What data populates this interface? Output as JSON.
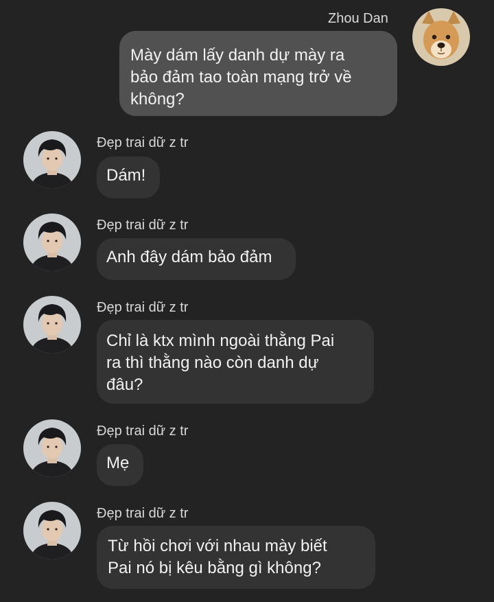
{
  "conversation": {
    "messages": [
      {
        "sender": "Zhou Dan",
        "direction": "outgoing",
        "avatar_icon": "dog-avatar-icon",
        "lines": [
          "Mày dám lấy danh dự mày ra",
          "bảo đảm tao toàn mạng trở về",
          "không?"
        ]
      },
      {
        "sender": "Đẹp trai dữ z tr",
        "direction": "incoming",
        "avatar_icon": "boy-avatar-icon",
        "lines": [
          "Dám!"
        ]
      },
      {
        "sender": "Đẹp trai dữ z tr",
        "direction": "incoming",
        "avatar_icon": "boy-avatar-icon",
        "lines": [
          "Anh đây dám bảo đảm"
        ]
      },
      {
        "sender": "Đẹp trai dữ z tr",
        "direction": "incoming",
        "avatar_icon": "boy-avatar-icon",
        "lines": [
          "Chỉ là ktx mình ngoài thằng Pai",
          "ra thì thằng nào còn danh dự",
          "đâu?"
        ]
      },
      {
        "sender": "Đẹp trai dữ z tr",
        "direction": "incoming",
        "avatar_icon": "boy-avatar-icon",
        "lines": [
          "Mẹ"
        ]
      },
      {
        "sender": "Đẹp trai dữ z tr",
        "direction": "incoming",
        "avatar_icon": "boy-avatar-icon",
        "lines": [
          "Từ hồi chơi với nhau mày biết",
          "Pai nó bị kêu bằng gì không?"
        ]
      }
    ]
  },
  "colors": {
    "background": "#232323",
    "outgoing_bubble": "#515151",
    "incoming_bubble": "#333333",
    "text": "#f2f2f2",
    "sender_name": "#d9d9d9"
  }
}
